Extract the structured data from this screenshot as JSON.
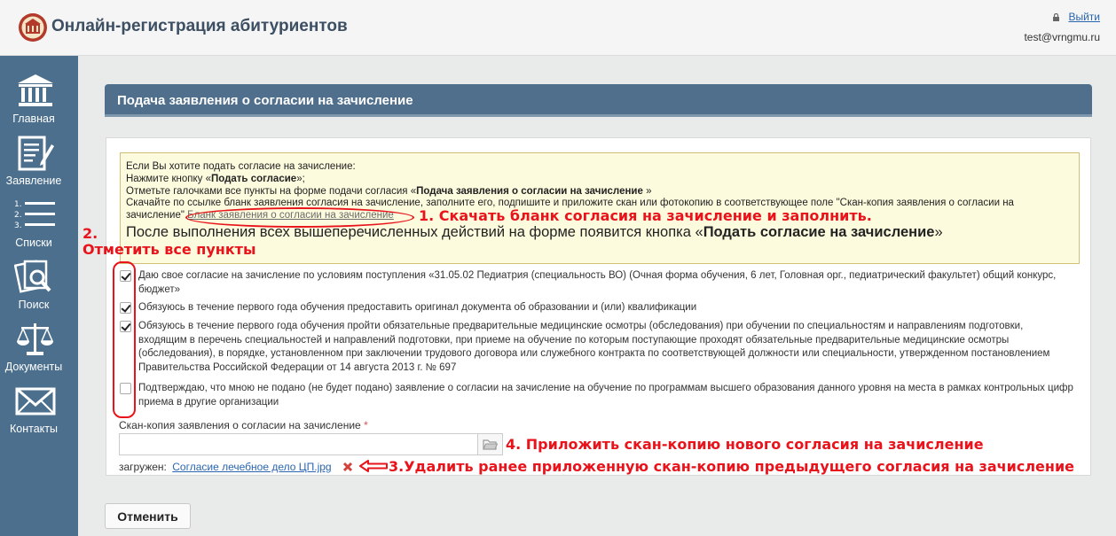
{
  "header": {
    "title": "Онлайн-регистрация абитуриентов",
    "logout_label": "Выйти",
    "user_email": "test@vrngmu.ru"
  },
  "sidebar": {
    "items": [
      {
        "label": "Главная",
        "icon": "building-columns-icon"
      },
      {
        "label": "Заявление",
        "icon": "document-pen-icon"
      },
      {
        "label": "Списки",
        "icon": "numbered-list-icon"
      },
      {
        "label": "Поиск",
        "icon": "search-documents-icon"
      },
      {
        "label": "Документы",
        "icon": "scales-icon"
      },
      {
        "label": "Контакты",
        "icon": "envelope-icon"
      }
    ]
  },
  "panel": {
    "title": "Подача заявления о согласии на зачисление"
  },
  "info": {
    "line1": "Если Вы хотите подать согласие на зачисление:",
    "line2_pre": "Нажмите кнопку «",
    "line2_bold": "Подать согласие",
    "line2_post": "»;",
    "line3_pre": "Отметьте галочками все пункты на форме подачи согласия «",
    "line3_bold": "Подача заявления о согласии на зачисление",
    "line3_post": " »",
    "line4": "Скачайте по ссылке бланк заявления согласия на зачисление, заполните его, подпишите и приложите скан или фотокопию в соответствующее поле \"Скан-копия заявления о согласии на зачисление\"",
    "download_link": "Бланк заявления о согласии на зачисление",
    "big_pre": "После выполнения всех вышеперечисленных действий на форме появится кнопка «",
    "big_bold": "Подать согласие на зачисление",
    "big_post": "»"
  },
  "checkboxes": [
    {
      "checked": true,
      "text": "Даю свое согласие на зачисление по условиям поступления «31.05.02 Педиатрия (специальность ВО) (Очная форма обучения, 6 лет, Головная орг., педиатрический факультет) общий конкурс, бюджет»"
    },
    {
      "checked": true,
      "text": "Обязуюсь в течение первого года обучения предоставить оригинал документа об образовании и (или) квалификации"
    },
    {
      "checked": true,
      "text": "Обязуюсь в течение первого года обучения пройти обязательные предварительные медицинские осмотры (обследования) при обучении по специальностям и направлениям подготовки, входящим в перечень специальностей и направлений подготовки, при приеме на обучение по которым поступающие проходят обязательные предварительные медицинские осмотры (обследования), в порядке, установленном при заключении трудового договора или служебного контракта по соответствующей должности или специальности, утвержденном постановлением Правительства Российской Федерации от 14 августа 2013 г. № 697"
    },
    {
      "checked": false,
      "text": "Подтверждаю, что мною не подано (не будет подано) заявление о согласии на зачисление на обучение по программам высшего образования данного уровня на места в рамках контрольных цифр приема в другие организации"
    }
  ],
  "scan": {
    "label": "Скан-копия заявления о согласии на зачисление",
    "required_mark": "*",
    "value": "",
    "loaded_label": "загружен:",
    "loaded_file": "Согласие лечебное дело ЦП.jpg"
  },
  "cancel_label": "Отменить",
  "annotations": {
    "a1": "1. Скачать бланк согласия на зачисление и заполнить.",
    "a2_line1": "2.",
    "a2_line2": "Отметить все пункты",
    "a3": "3.Удалить ранее приложенную скан-копию предыдущего согласия на зачисление",
    "a4": "4. Приложить скан-копию нового согласия на зачисление",
    "color": "#e8131b"
  },
  "colors": {
    "sidebar": "#4b6f8c",
    "panel_header": "#4f6f8c",
    "info_bg": "#fdfbdd",
    "link": "#2a66b0"
  }
}
